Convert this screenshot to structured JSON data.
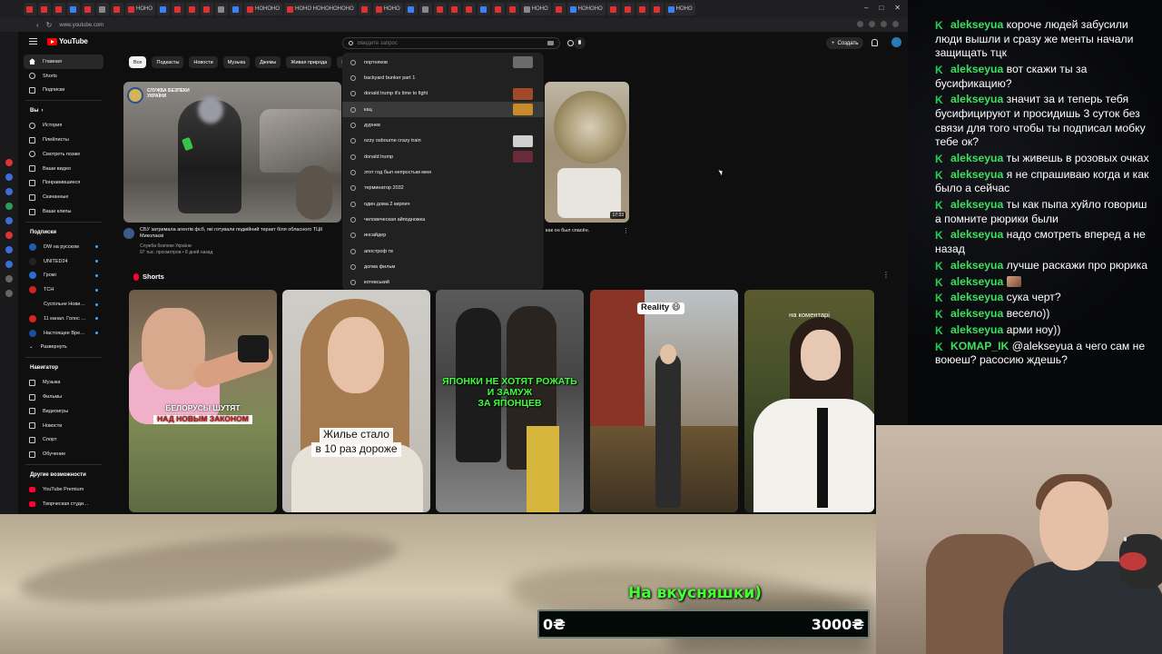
{
  "browser": {
    "tabs": [
      "",
      "",
      "",
      "",
      "",
      "",
      "",
      "НОНО",
      "",
      "",
      "",
      "",
      "",
      "",
      "НОНОНО",
      "НОНО НОНОНОНОНО",
      "",
      "НОНО",
      "",
      "",
      "",
      "",
      "",
      "",
      "",
      "",
      "НОНО",
      "",
      "НОНОНО",
      "",
      "",
      "",
      "",
      "НОНО"
    ],
    "url": "www.youtube.com"
  },
  "youtube": {
    "logo_text": "YouTube",
    "search_placeholder": "Введите запрос",
    "create_label": "Создать",
    "sidebar": {
      "main": [
        {
          "label": "Главная",
          "active": true
        },
        {
          "label": "Shorts"
        },
        {
          "label": "Подписки"
        }
      ],
      "you_header": "Вы",
      "you": [
        "История",
        "Плейлисты",
        "Смотреть позже",
        "Ваши видео",
        "Понравившиеся",
        "Скачанные",
        "Ваши клипы"
      ],
      "subs_header": "Подписки",
      "subs": [
        {
          "label": "DW на русском",
          "color": "#1b5fb0"
        },
        {
          "label": "UNITED24",
          "color": "#222"
        },
        {
          "label": "Громі",
          "color": "#2d6bd0"
        },
        {
          "label": "ТСН",
          "color": "#c22"
        },
        {
          "label": "Суспільне Нови…",
          "color": "#111"
        },
        {
          "label": "11 канал. Голос …",
          "color": "#d22"
        },
        {
          "label": "Настоящее Вре…",
          "color": "#1a4d9c"
        }
      ],
      "expand_label": "Развернуть",
      "nav_header": "Навигатор",
      "nav": [
        "Музыка",
        "Фильмы",
        "Видеоигры",
        "Новости",
        "Спорт",
        "Обучение"
      ],
      "more_header": "Другие возможности",
      "more": [
        "YouTube Premium",
        "Творческая студи…"
      ]
    },
    "chips": [
      "Все",
      "Подкасты",
      "Новости",
      "Музыка",
      "Джемы",
      "Живая природа",
      "Н"
    ],
    "video1": {
      "badge": "СЛУЖБА БЕЗПЕКИ УКРАЇНИ",
      "title": "СБУ затримала агентів фсб, які готували подвійний теракт біля обласного ТЦК Миколаєві",
      "channel": "Служба безпеки України",
      "stats": "97 тыс. просмотров • 8 дней назад"
    },
    "video2": {
      "title": "как он был спасён.",
      "duration": "17:33"
    },
    "suggestions": [
      "портняков",
      "backyard bunker part 1",
      "donald trump it's time to fight",
      "кац",
      "дурнев",
      "ozzy osbourne crazy train",
      "donald trump",
      "этот год был непростым мем",
      "терминатор 2032",
      "один дома 2 кирпич",
      "человеческая айподножка",
      "инсайдер",
      "апостроф тв",
      "догма фильм",
      "котевський"
    ],
    "shorts_title": "Shorts",
    "shorts": [
      {
        "caption_top": "БЕЛОРУСЫ ШУТЯТ",
        "caption_bottom": "НАД НОВЫМ ЗАКОНОМ"
      },
      {
        "caption_top": "Жилье стало",
        "caption_bottom": "в 10 раз дороже"
      },
      {
        "caption_top": "ЯПОНКИ НЕ ХОТЯТ РОЖАТЬ И ЗАМУЖ",
        "caption_bottom": "ЗА ЯПОНЦЕВ"
      },
      {
        "caption_top": "Reality 😄",
        "caption_bottom": ""
      },
      {
        "caption_top": "на коментарі",
        "caption_bottom": ""
      }
    ]
  },
  "chat": {
    "messages": [
      {
        "nick": "alekseyua",
        "text": "короче людей забусили люди вышли и сразу же менты начали защищать тцк"
      },
      {
        "nick": "alekseyua",
        "text": "вот скажи ты за бусификацию?"
      },
      {
        "nick": "alekseyua",
        "text": "значит за и теперь тебя бусифицируют и просидишь 3 суток без связи для того чтобы ты подписал мобку тебе ок?"
      },
      {
        "nick": "alekseyua",
        "text": "ты живешь в розовых очках"
      },
      {
        "nick": "alekseyua",
        "text": "я не спрашиваю когда и как было а сейчас"
      },
      {
        "nick": "alekseyua",
        "text": "ты как пыпа хуйло говориш а помните рюрики были"
      },
      {
        "nick": "alekseyua",
        "text": "надо смотреть вперед а не назад"
      },
      {
        "nick": "alekseyua",
        "text": "лучше раскажи про рюрика"
      },
      {
        "nick": "alekseyua",
        "text": "",
        "emote": true
      },
      {
        "nick": "alekseyua",
        "text": "сука черт?"
      },
      {
        "nick": "alekseyua",
        "text": "весело))"
      },
      {
        "nick": "alekseyua",
        "text": "арми ноу))"
      },
      {
        "nick": "KOMAP_IK",
        "text": "@alekseyua а чего сам не воюеш? расосию ждешь?"
      }
    ]
  },
  "donation": {
    "label": "На вкусняшки)",
    "min": "0₴",
    "max": "3000₴",
    "progress": 0
  }
}
